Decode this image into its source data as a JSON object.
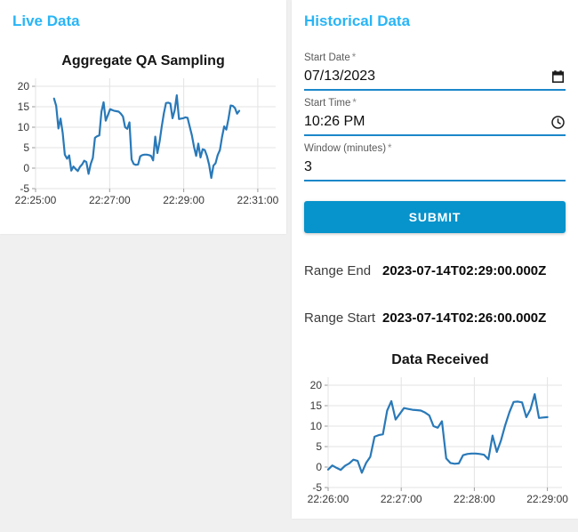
{
  "theme": {
    "accent": "#29b5f6",
    "button_bg": "#0793cb",
    "underline": "#1b87c9",
    "line_color": "#2979b8",
    "grid_color": "#e3e3e3",
    "page_bg": "#f0f0f0",
    "card_bg": "#ffffff"
  },
  "live_panel": {
    "title": "Live Data"
  },
  "historical_panel": {
    "title": "Historical Data",
    "fields": [
      {
        "label": "Start Date",
        "required_marker": "*",
        "value": "07/13/2023",
        "icon": "calendar-icon"
      },
      {
        "label": "Start Time",
        "required_marker": "*",
        "value": "10:26 PM",
        "icon": "clock-icon"
      },
      {
        "label": "Window (minutes)",
        "required_marker": "*",
        "value": "3",
        "icon": null
      }
    ],
    "submit_label": "SUBMIT",
    "results": [
      {
        "label": "Range End",
        "value": "2023-07-14T02:29:00.000Z"
      },
      {
        "label": "Range Start",
        "value": "2023-07-14T02:26:00.000Z"
      }
    ]
  },
  "chart_data": [
    {
      "type": "line",
      "title": "Aggregate QA Sampling",
      "xlabel": "",
      "ylabel": "",
      "ylim": [
        -5,
        20
      ],
      "y_ticks": [
        20,
        15,
        10,
        5,
        0,
        -5
      ],
      "x_domain": [
        "22:25:00",
        "22:31:00"
      ],
      "x_ticks": [
        "22:25:00",
        "22:27:00",
        "22:29:00",
        "22:31:00"
      ],
      "x_pad_seconds": 29,
      "grid": true,
      "legend": "none",
      "data_start": "22:25:30",
      "data_end": "22:30:30",
      "values": [
        17.0,
        15.2,
        9.7,
        12.1,
        8.6,
        3.3,
        2.3,
        3.1,
        -0.6,
        0.4,
        -0.2,
        -0.7,
        0.3,
        0.9,
        1.8,
        1.5,
        -1.4,
        1.0,
        2.5,
        7.4,
        7.8,
        8.0,
        13.8,
        16.1,
        11.6,
        13.0,
        14.4,
        14.2,
        14.0,
        13.9,
        13.8,
        13.3,
        12.6,
        10.0,
        9.6,
        11.2,
        2.1,
        1.0,
        0.8,
        0.9,
        2.9,
        3.2,
        3.3,
        3.3,
        3.2,
        3.0,
        1.9,
        7.7,
        3.7,
        6.5,
        10.2,
        13.4,
        15.9,
        16.0,
        15.8,
        12.2,
        14.1,
        17.8,
        12.0,
        12.1,
        12.2,
        12.4,
        12.3,
        10.1,
        8.0,
        5.2,
        3.0,
        6.0,
        2.6,
        4.6,
        4.4,
        3.0,
        0.8,
        -2.4,
        0.6,
        1.2,
        3.2,
        4.4,
        7.6,
        10.2,
        9.4,
        12.0,
        15.3,
        15.2,
        14.7,
        13.3,
        14.0
      ]
    },
    {
      "type": "line",
      "title": "Data Received",
      "xlabel": "",
      "ylabel": "",
      "ylim": [
        -5,
        20
      ],
      "y_ticks": [
        20,
        15,
        10,
        5,
        0,
        -5
      ],
      "x_domain": [
        "22:26:00",
        "22:29:00"
      ],
      "x_ticks": [
        "22:26:00",
        "22:27:00",
        "22:28:00",
        "22:29:00"
      ],
      "x_pad_seconds": 12,
      "grid": true,
      "legend": "none",
      "data_start": "22:26:00",
      "data_end": "22:29:00",
      "values": [
        -0.6,
        0.4,
        -0.2,
        -0.7,
        0.3,
        0.9,
        1.8,
        1.5,
        -1.4,
        1.0,
        2.5,
        7.4,
        7.8,
        8.0,
        13.8,
        16.1,
        11.6,
        13.0,
        14.4,
        14.2,
        14.0,
        13.9,
        13.8,
        13.3,
        12.6,
        10.0,
        9.6,
        11.2,
        2.1,
        1.0,
        0.8,
        0.9,
        2.9,
        3.2,
        3.3,
        3.3,
        3.2,
        3.0,
        1.9,
        7.7,
        3.7,
        6.5,
        10.2,
        13.4,
        15.9,
        16.0,
        15.8,
        12.2,
        14.1,
        17.8,
        12.0,
        12.1,
        12.2
      ]
    }
  ]
}
